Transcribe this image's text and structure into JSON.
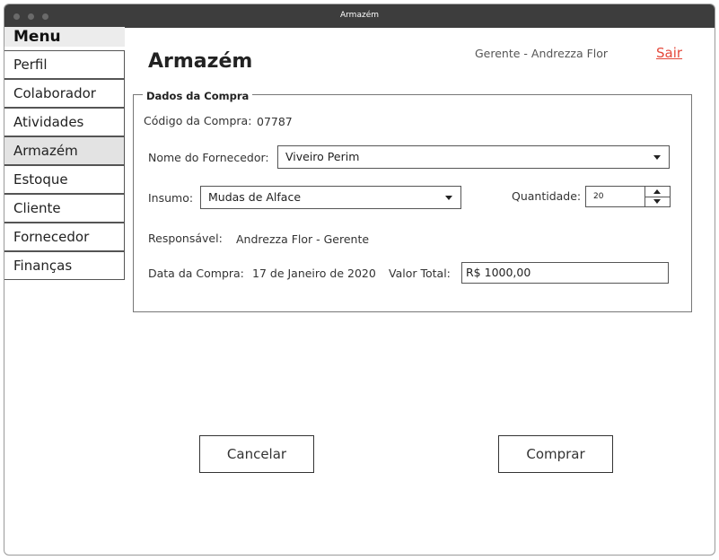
{
  "window": {
    "title": "Armazém"
  },
  "menu": {
    "header": "Menu",
    "items": [
      {
        "label": "Perfil"
      },
      {
        "label": "Colaborador"
      },
      {
        "label": "Atividades"
      },
      {
        "label": "Armazém",
        "active": true
      },
      {
        "label": "Estoque"
      },
      {
        "label": "Cliente"
      },
      {
        "label": "Fornecedor"
      },
      {
        "label": "Finanças"
      }
    ]
  },
  "header": {
    "title": "Armazém",
    "user": "Gerente - Andrezza Flor",
    "logout": "Sair"
  },
  "form": {
    "legend": "Dados da Compra",
    "code_label": "Código da Compra:",
    "code_value": "07787",
    "supplier_label": "Nome do Fornecedor:",
    "supplier_value": "Viveiro Perim",
    "input_label": "Insumo:",
    "input_value": "Mudas de Alface",
    "quantity_label": "Quantidade:",
    "quantity_value": "20",
    "responsible_label": "Responsável:",
    "responsible_value": "Andrezza Flor - Gerente",
    "date_label": "Data da Compra:",
    "date_value": "17 de Janeiro de 2020",
    "total_label": "Valor Total:",
    "total_value": "R$ 1000,00"
  },
  "actions": {
    "cancel": "Cancelar",
    "buy": "Comprar"
  },
  "colors": {
    "accent_link": "#e4483a",
    "titlebar": "#3d3d3d"
  }
}
